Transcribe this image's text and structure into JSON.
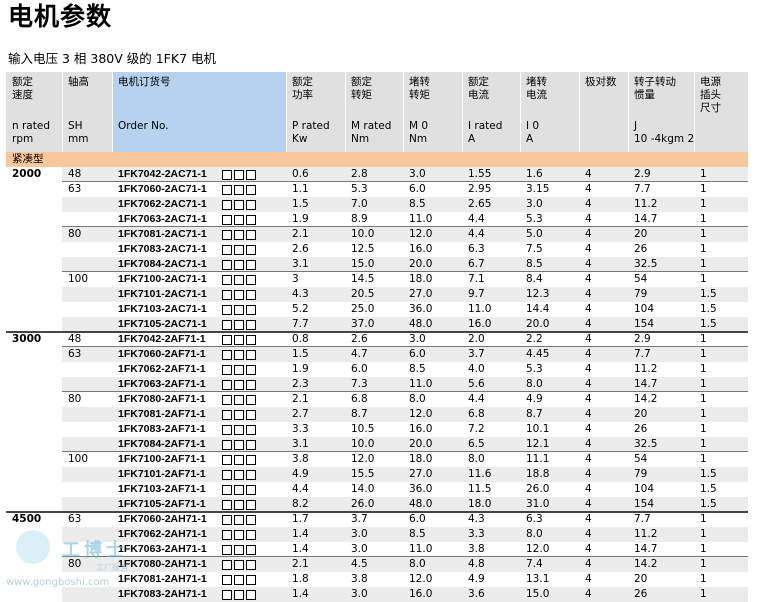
{
  "page": {
    "title": "电机参数",
    "subtitle": "输入电压 3 相 380V 级的 1FK7 电机"
  },
  "table": {
    "headers": [
      {
        "zh": "额定\n速度",
        "en": "n rated\nrpm"
      },
      {
        "zh": "轴高",
        "en": "SH\nmm"
      },
      {
        "zh": "电机订货号",
        "en": "Order No."
      },
      {
        "zh": "额定\n功率",
        "en": "P rated\nKw"
      },
      {
        "zh": "额定\n转矩",
        "en": "M rated\nNm"
      },
      {
        "zh": "堵转\n转矩",
        "en": "M 0\nNm"
      },
      {
        "zh": "额定\n电流",
        "en": "I rated\nA"
      },
      {
        "zh": "堵转\n电流",
        "en": "I 0\nA"
      },
      {
        "zh": "极对数",
        "en": ""
      },
      {
        "zh": "转子转动\n惯量",
        "en": "J\n10 -4kgm 2"
      },
      {
        "zh": "电源\n插头\n尺寸",
        "en": ""
      }
    ],
    "category": "紧凑型",
    "speeds": [
      "2000",
      "3000",
      "4500"
    ],
    "rows": [
      {
        "speed": "2000",
        "sh": "48",
        "order": "1FK7042-2AC71-1",
        "p": "0.6",
        "mr": "2.8",
        "m0": "3.0",
        "ir": "1.55",
        "i0": "1.6",
        "poles": "4",
        "j": "2.9",
        "plug": "1"
      },
      {
        "speed": "",
        "sh": "63",
        "order": "1FK7060-2AC71-1",
        "p": "1.1",
        "mr": "5.3",
        "m0": "6.0",
        "ir": "2.95",
        "i0": "3.15",
        "poles": "4",
        "j": "7.7",
        "plug": "1"
      },
      {
        "speed": "",
        "sh": "",
        "order": "1FK7062-2AC71-1",
        "p": "1.5",
        "mr": "7.0",
        "m0": "8.5",
        "ir": "2.65",
        "i0": "3.0",
        "poles": "4",
        "j": "11.2",
        "plug": "1"
      },
      {
        "speed": "",
        "sh": "",
        "order": "1FK7063-2AC71-1",
        "p": "1.9",
        "mr": "8.9",
        "m0": "11.0",
        "ir": "4.4",
        "i0": "5.3",
        "poles": "4",
        "j": "14.7",
        "plug": "1"
      },
      {
        "speed": "",
        "sh": "80",
        "order": "1FK7081-2AC71-1",
        "p": "2.1",
        "mr": "10.0",
        "m0": "12.0",
        "ir": "4.4",
        "i0": "5.0",
        "poles": "4",
        "j": "20",
        "plug": "1"
      },
      {
        "speed": "",
        "sh": "",
        "order": "1FK7083-2AC71-1",
        "p": "2.6",
        "mr": "12.5",
        "m0": "16.0",
        "ir": "6.3",
        "i0": "7.5",
        "poles": "4",
        "j": "26",
        "plug": "1"
      },
      {
        "speed": "",
        "sh": "",
        "order": "1FK7084-2AC71-1",
        "p": "3.1",
        "mr": "15.0",
        "m0": "20.0",
        "ir": "6.7",
        "i0": "8.5",
        "poles": "4",
        "j": "32.5",
        "plug": "1"
      },
      {
        "speed": "",
        "sh": "100",
        "order": "1FK7100-2AC71-1",
        "p": "3",
        "mr": "14.5",
        "m0": "18.0",
        "ir": "7.1",
        "i0": "8.4",
        "poles": "4",
        "j": "54",
        "plug": "1"
      },
      {
        "speed": "",
        "sh": "",
        "order": "1FK7101-2AC71-1",
        "p": "4.3",
        "mr": "20.5",
        "m0": "27.0",
        "ir": "9.7",
        "i0": "12.3",
        "poles": "4",
        "j": "79",
        "plug": "1.5"
      },
      {
        "speed": "",
        "sh": "",
        "order": "1FK7103-2AC71-1",
        "p": "5.2",
        "mr": "25.0",
        "m0": "36.0",
        "ir": "11.0",
        "i0": "14.4",
        "poles": "4",
        "j": "104",
        "plug": "1.5"
      },
      {
        "speed": "",
        "sh": "",
        "order": "1FK7105-2AC71-1",
        "p": "7.7",
        "mr": "37.0",
        "m0": "48.0",
        "ir": "16.0",
        "i0": "20.0",
        "poles": "4",
        "j": "154",
        "plug": "1.5"
      },
      {
        "speed": "3000",
        "sh": "48",
        "order": "1FK7042-2AF71-1",
        "p": "0.8",
        "mr": "2.6",
        "m0": "3.0",
        "ir": "2.0",
        "i0": "2.2",
        "poles": "4",
        "j": "2.9",
        "plug": "1"
      },
      {
        "speed": "",
        "sh": "63",
        "order": "1FK7060-2AF71-1",
        "p": "1.5",
        "mr": "4.7",
        "m0": "6.0",
        "ir": "3.7",
        "i0": "4.45",
        "poles": "4",
        "j": "7.7",
        "plug": "1"
      },
      {
        "speed": "",
        "sh": "",
        "order": "1FK7062-2AF71-1",
        "p": "1.9",
        "mr": "6.0",
        "m0": "8.5",
        "ir": "4.0",
        "i0": "5.3",
        "poles": "4",
        "j": "11.2",
        "plug": "1"
      },
      {
        "speed": "",
        "sh": "",
        "order": "1FK7063-2AF71-1",
        "p": "2.3",
        "mr": "7.3",
        "m0": "11.0",
        "ir": "5.6",
        "i0": "8.0",
        "poles": "4",
        "j": "14.7",
        "plug": "1"
      },
      {
        "speed": "",
        "sh": "80",
        "order": "1FK7080-2AF71-1",
        "p": "2.1",
        "mr": "6.8",
        "m0": "8.0",
        "ir": "4.4",
        "i0": "4.9",
        "poles": "4",
        "j": "14.2",
        "plug": "1"
      },
      {
        "speed": "",
        "sh": "",
        "order": "1FK7081-2AF71-1",
        "p": "2.7",
        "mr": "8.7",
        "m0": "12.0",
        "ir": "6.8",
        "i0": "8.7",
        "poles": "4",
        "j": "20",
        "plug": "1"
      },
      {
        "speed": "",
        "sh": "",
        "order": "1FK7083-2AF71-1",
        "p": "3.3",
        "mr": "10.5",
        "m0": "16.0",
        "ir": "7.2",
        "i0": "10.1",
        "poles": "4",
        "j": "26",
        "plug": "1"
      },
      {
        "speed": "",
        "sh": "",
        "order": "1FK7084-2AF71-1",
        "p": "3.1",
        "mr": "10.0",
        "m0": "20.0",
        "ir": "6.5",
        "i0": "12.1",
        "poles": "4",
        "j": "32.5",
        "plug": "1"
      },
      {
        "speed": "",
        "sh": "100",
        "order": "1FK7100-2AF71-1",
        "p": "3.8",
        "mr": "12.0",
        "m0": "18.0",
        "ir": "8.0",
        "i0": "11.1",
        "poles": "4",
        "j": "54",
        "plug": "1"
      },
      {
        "speed": "",
        "sh": "",
        "order": "1FK7101-2AF71-1",
        "p": "4.9",
        "mr": "15.5",
        "m0": "27.0",
        "ir": "11.6",
        "i0": "18.8",
        "poles": "4",
        "j": "79",
        "plug": "1.5"
      },
      {
        "speed": "",
        "sh": "",
        "order": "1FK7103-2AF71-1",
        "p": "4.4",
        "mr": "14.0",
        "m0": "36.0",
        "ir": "11.5",
        "i0": "26.0",
        "poles": "4",
        "j": "104",
        "plug": "1.5"
      },
      {
        "speed": "",
        "sh": "",
        "order": "1FK7105-2AF71-1",
        "p": "8.2",
        "mr": "26.0",
        "m0": "48.0",
        "ir": "18.0",
        "i0": "31.0",
        "poles": "4",
        "j": "154",
        "plug": "1.5"
      },
      {
        "speed": "4500",
        "sh": "63",
        "order": "1FK7060-2AH71-1",
        "p": "1.7",
        "mr": "3.7",
        "m0": "6.0",
        "ir": "4.3",
        "i0": "6.3",
        "poles": "4",
        "j": "7.7",
        "plug": "1"
      },
      {
        "speed": "",
        "sh": "",
        "order": "1FK7062-2AH71-1",
        "p": "1.4",
        "mr": "3.0",
        "m0": "8.5",
        "ir": "3.3",
        "i0": "8.0",
        "poles": "4",
        "j": "11.2",
        "plug": "1"
      },
      {
        "speed": "",
        "sh": "",
        "order": "1FK7063-2AH71-1",
        "p": "1.4",
        "mr": "3.0",
        "m0": "11.0",
        "ir": "3.8",
        "i0": "12.0",
        "poles": "4",
        "j": "14.7",
        "plug": "1"
      },
      {
        "speed": "",
        "sh": "80",
        "order": "1FK7080-2AH71-1",
        "p": "2.1",
        "mr": "4.5",
        "m0": "8.0",
        "ir": "4.8",
        "i0": "7.4",
        "poles": "4",
        "j": "14.2",
        "plug": "1"
      },
      {
        "speed": "",
        "sh": "",
        "order": "1FK7081-2AH71-1",
        "p": "1.8",
        "mr": "3.8",
        "m0": "12.0",
        "ir": "4.9",
        "i0": "13.1",
        "poles": "4",
        "j": "20",
        "plug": "1"
      },
      {
        "speed": "",
        "sh": "",
        "order": "1FK7083-2AH71-1",
        "p": "1.4",
        "mr": "3.0",
        "m0": "16.0",
        "ir": "3.6",
        "i0": "15.0",
        "poles": "4",
        "j": "26",
        "plug": "1"
      }
    ]
  },
  "watermark": {
    "text": "工博士",
    "small": "工厂服务",
    "url": "www.gongboshi.com"
  }
}
